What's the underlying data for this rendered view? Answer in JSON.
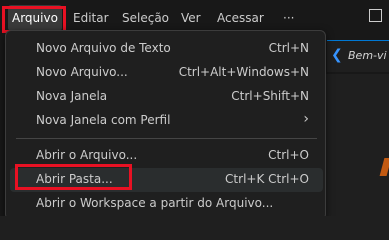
{
  "menubar": {
    "items": [
      "Arquivo",
      "Editar",
      "Seleção",
      "Ver",
      "Acessar",
      "···"
    ]
  },
  "editor": {
    "tab_label": "Bem-vi"
  },
  "file_menu": {
    "items": [
      {
        "label": "Novo Arquivo de Texto",
        "shortcut": "Ctrl+N"
      },
      {
        "label": "Novo Arquivo...",
        "shortcut": "Ctrl+Alt+Windows+N"
      },
      {
        "label": "Nova Janela",
        "shortcut": "Ctrl+Shift+N"
      },
      {
        "label": "Nova Janela com Perfil",
        "shortcut": ""
      },
      {
        "label": "Abrir o Arquivo...",
        "shortcut": "Ctrl+O"
      },
      {
        "label": "Abrir Pasta...",
        "shortcut": "Ctrl+K Ctrl+O"
      },
      {
        "label": "Abrir o Workspace a partir do Arquivo...",
        "shortcut": ""
      }
    ]
  },
  "colors": {
    "highlight_box": "#e81123",
    "menu_background": "#1f1f1f",
    "accent": "#0078d4"
  }
}
